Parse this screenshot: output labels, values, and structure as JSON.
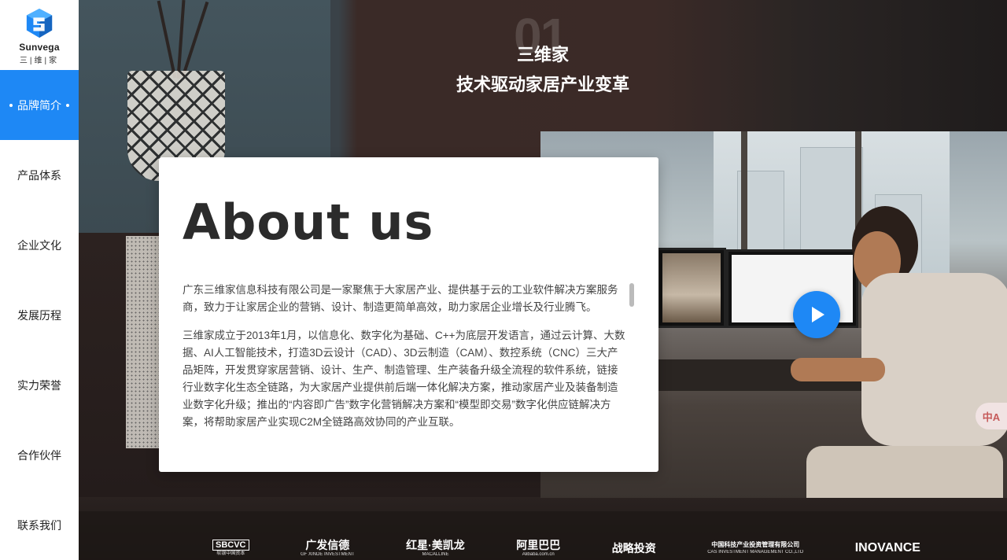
{
  "brand": {
    "name": "Sunvega",
    "name_cn": "三|维|家"
  },
  "nav": [
    {
      "label": "品牌简介",
      "active": true
    },
    {
      "label": "产品体系",
      "active": false
    },
    {
      "label": "企业文化",
      "active": false
    },
    {
      "label": "发展历程",
      "active": false
    },
    {
      "label": "实力荣誉",
      "active": false
    },
    {
      "label": "合作伙伴",
      "active": false
    },
    {
      "label": "联系我们",
      "active": false
    }
  ],
  "heading": {
    "number": "01",
    "title": "三维家",
    "subtitle": "技术驱动家居产业变革"
  },
  "about": {
    "title": "About us",
    "paragraphs": [
      "广东三维家信息科技有限公司是一家聚焦于大家居产业、提供基于云的工业软件解决方案服务商，致力于让家居企业的营销、设计、制造更简单高效，助力家居企业增长及行业腾飞。",
      "三维家成立于2013年1月，以信息化、数字化为基础、C++为底层开发语言，通过云计算、大数据、AI人工智能技术，打造3D云设计（CAD）、3D云制造（CAM）、数控系统（CNC）三大产品矩阵，开发贯穿家居营销、设计、生产、制造管理、生产装备升级全流程的软件系统，链接行业数字化生态全链路，为大家居产业提供前后端一体化解决方案，推动家居产业及装备制造业数字化升级；推出的“内容即广告”数字化营销解决方案和“模型即交易”数字化供应链解决方案，将帮助家居产业实现C2M全链路高效协同的产业互联。"
    ]
  },
  "translate_badge": "中A",
  "partners": [
    {
      "name": "SBCVC",
      "sub": "软银中国资本"
    },
    {
      "name": "广发信德",
      "sub": "GF XINDE INVESTMENT"
    },
    {
      "name": "红星·美凯龙",
      "sub": "MACALLINE"
    },
    {
      "name": "阿里巴巴",
      "sub": "Alibaba.com.cn"
    },
    {
      "name": "战略投资",
      "sub": ""
    },
    {
      "name": "中国科技产业投资管理有限公司",
      "sub": "CAS INVESTMENT MANAGEMENT CO.,LTD"
    },
    {
      "name": "INOVANCE",
      "sub": ""
    }
  ],
  "colors": {
    "accent": "#1e88f5",
    "card_bg": "#ffffff",
    "sidebar_bg": "#ffffff"
  },
  "icons": {
    "logo": "sunvega-cube-logo-icon",
    "play": "play-icon",
    "translate": "translate-icon"
  }
}
